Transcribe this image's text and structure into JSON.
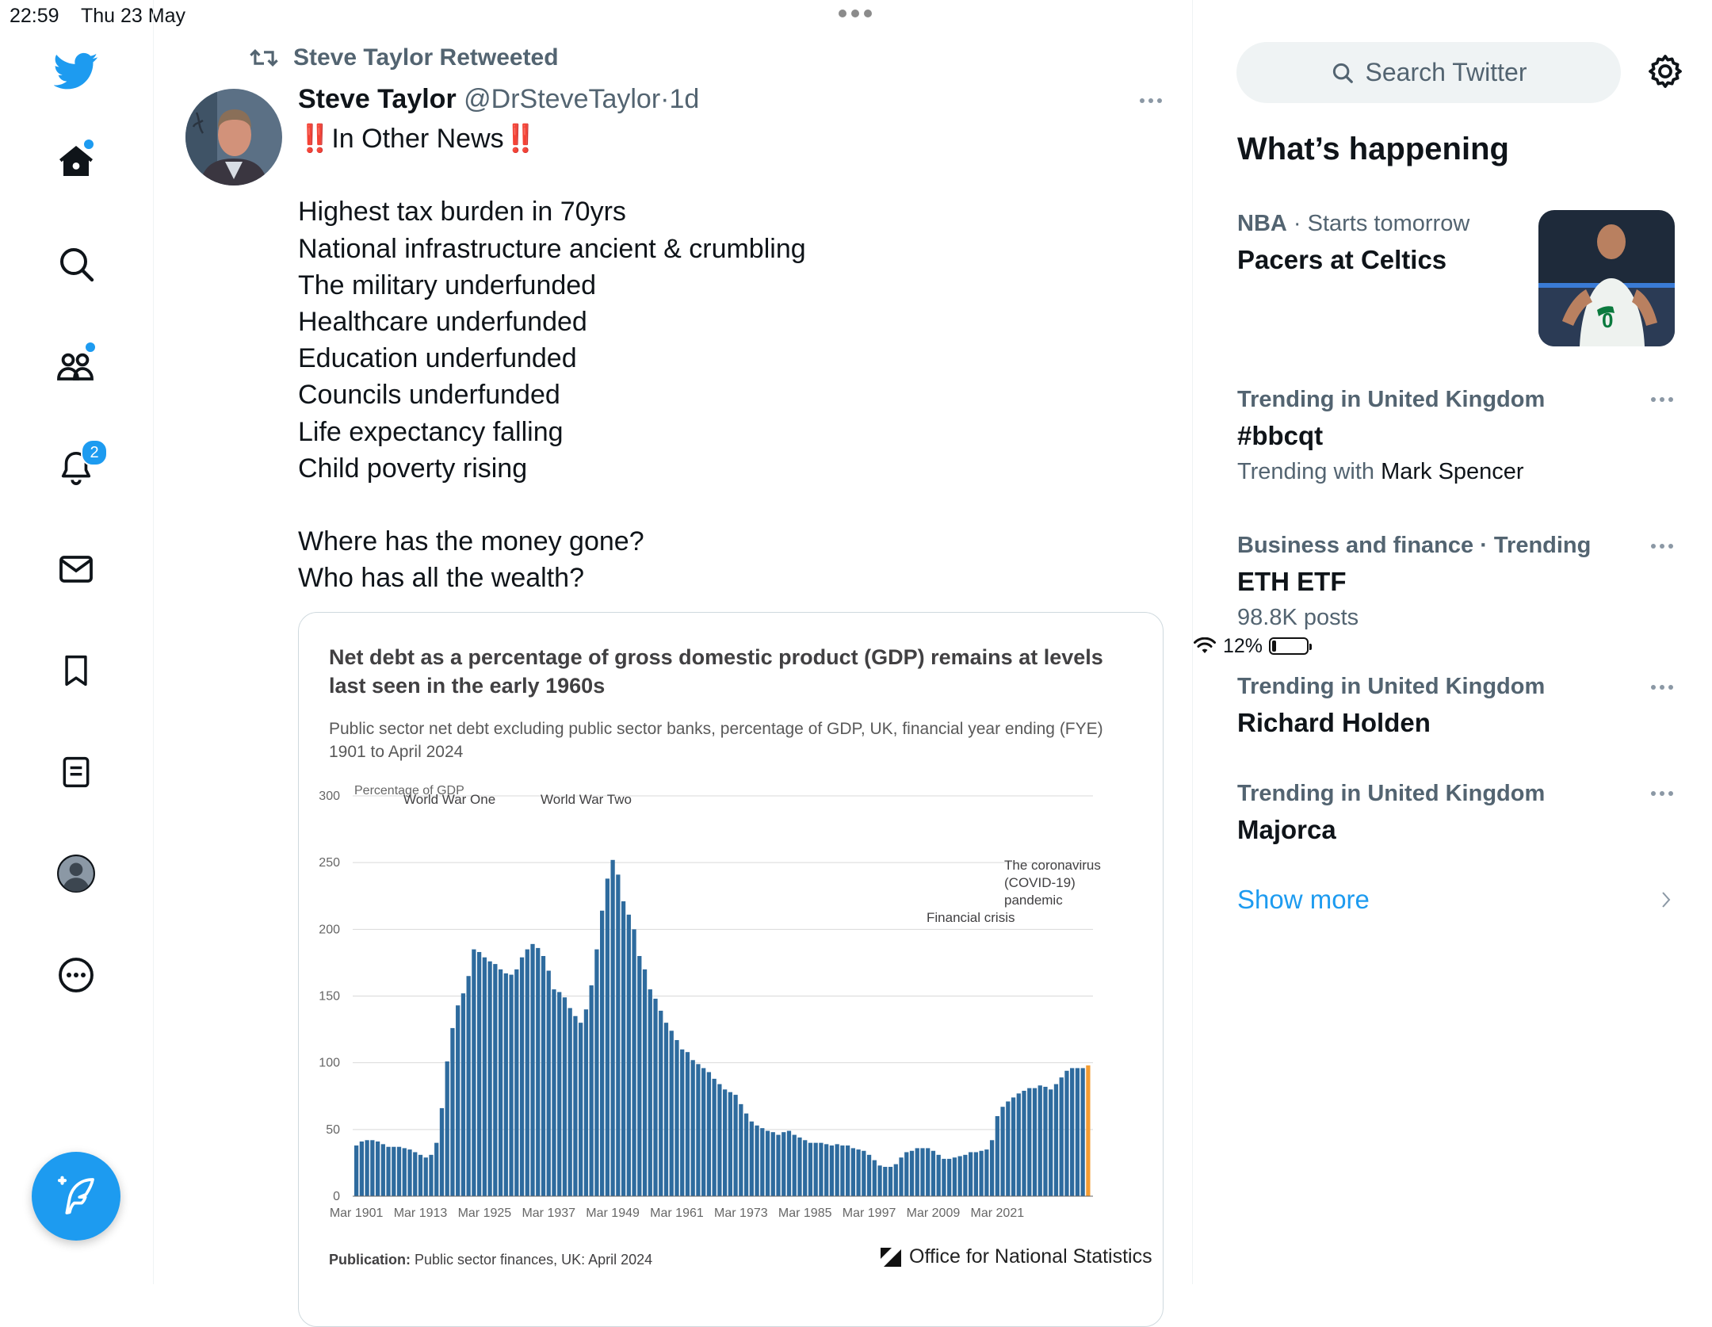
{
  "status_bar": {
    "time": "22:59",
    "date": "Thu 23 May",
    "battery": "12%",
    "battery_level": 0.12
  },
  "nav": {
    "notifications_badge": "2"
  },
  "tweet": {
    "retweeted_by": "Steve Taylor Retweeted",
    "author_name": "Steve Taylor",
    "author_handle": "@DrSteveTaylor",
    "separator": "·",
    "age": "1d",
    "headline": "In Other News",
    "headline_marks": "‼️",
    "lines": [
      "Highest tax burden in 70yrs",
      "National infrastructure ancient & crumbling",
      "The military underfunded",
      "Healthcare underfunded",
      "Education underfunded",
      "Councils underfunded",
      "Life expectancy falling",
      "Child poverty rising",
      "",
      "Where has the money gone?",
      "Who has all the wealth?"
    ]
  },
  "media_card": {
    "title": "Net debt as a percentage of gross domestic product (GDP) remains at levels last seen in the early 1960s",
    "subtitle": "Public sector net debt excluding public sector banks, percentage of GDP, UK, financial year ending (FYE) 1901 to April 2024",
    "footer_label": "Publication:",
    "footer_value": "Public sector finances, UK: April 2024",
    "publisher": "Office for National Statistics"
  },
  "chart_data": {
    "type": "bar",
    "ylabel": "Percentage of GDP",
    "ylim": [
      0,
      300
    ],
    "yticks": [
      0,
      50,
      100,
      150,
      200,
      250,
      300
    ],
    "xtick_labels": [
      "Mar 1901",
      "Mar 1913",
      "Mar 1925",
      "Mar 1937",
      "Mar 1949",
      "Mar 1961",
      "Mar 1973",
      "Mar 1985",
      "Mar 1997",
      "Mar 2009",
      "Mar 2021"
    ],
    "grid": "horizontal",
    "annotations": [
      "World War One",
      "World War Two",
      "The coronavirus",
      "(COVID-19)",
      "pandemic",
      "Financial crisis"
    ],
    "x_start_year": 1901,
    "values": [
      38,
      41,
      42,
      42,
      41,
      39,
      37,
      37,
      37,
      36,
      35,
      33,
      31,
      29,
      31,
      40,
      66,
      101,
      126,
      143,
      152,
      165,
      185,
      183,
      179,
      176,
      174,
      170,
      167,
      166,
      170,
      179,
      185,
      189,
      186,
      180,
      169,
      155,
      153,
      149,
      141,
      135,
      130,
      140,
      158,
      185,
      214,
      238,
      252,
      241,
      221,
      211,
      200,
      180,
      170,
      155,
      148,
      139,
      130,
      124,
      117,
      110,
      108,
      102,
      99,
      96,
      93,
      88,
      84,
      80,
      78,
      76,
      69,
      62,
      56,
      53,
      51,
      49,
      48,
      46,
      48,
      49,
      46,
      44,
      42,
      40,
      40,
      40,
      39,
      38,
      39,
      38,
      38,
      36,
      35,
      34,
      31,
      27,
      23,
      22,
      22,
      24,
      29,
      33,
      34,
      36,
      36,
      36,
      34,
      31,
      28,
      28,
      29,
      30,
      31,
      33,
      33,
      34,
      35,
      42,
      60,
      67,
      71,
      74,
      77,
      79,
      81,
      81,
      83,
      82,
      80,
      84,
      89,
      94,
      96,
      96,
      96,
      98
    ]
  },
  "sidebar": {
    "search_placeholder": "Search Twitter",
    "section_title": "What’s happening",
    "trends": [
      {
        "category": "NBA",
        "meta_extra": "Starts tomorrow",
        "title": "Pacers at Celtics",
        "subtitle": ""
      },
      {
        "category": "Trending in United Kingdom",
        "title": "#bbcqt",
        "subtitle_prefix": "Trending with",
        "subtitle_name": "Mark Spencer"
      },
      {
        "category": "Business and finance · Trending",
        "title": "ETH ETF",
        "subtitle": "98.8K posts"
      },
      {
        "category": "Trending in United Kingdom",
        "title": "Richard Holden"
      },
      {
        "category": "Trending in United Kingdom",
        "title": "Majorca"
      }
    ],
    "show_more": "Show more"
  },
  "colors": {
    "accent": "#1d9bf0",
    "text": "#0f1419",
    "muted": "#536471",
    "bar": "#2e6b9e",
    "bar_latest": "#f39c33"
  }
}
